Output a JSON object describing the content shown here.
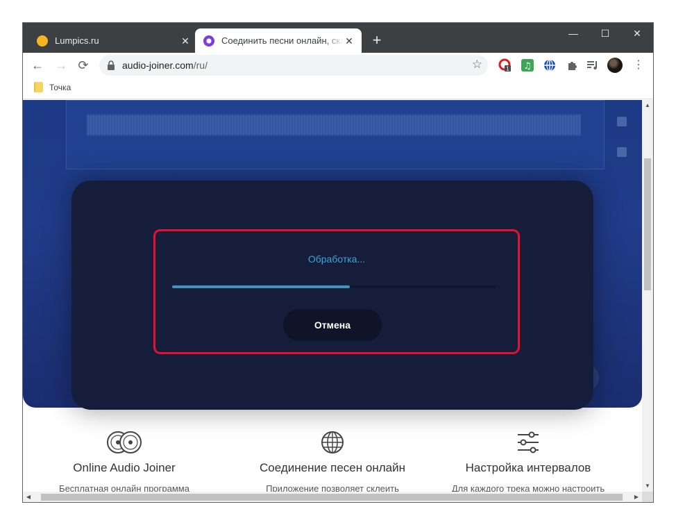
{
  "tabs": [
    {
      "title": "Lumpics.ru",
      "favicon_color": "#f4b623",
      "close": "✕"
    },
    {
      "title": "Соединить песни онлайн, склеить",
      "favicon_color": "#7b3ce0",
      "close": "✕"
    }
  ],
  "new_tab_label": "+",
  "window_controls": {
    "minimize": "—",
    "maximize": "☐",
    "close": "✕"
  },
  "toolbar": {
    "back": "←",
    "forward": "→",
    "reload": "⟳",
    "url_host": "audio-joiner.com",
    "url_path": "/ru/",
    "ext_badge": "1",
    "star": "☆",
    "menu": "⋮"
  },
  "bookmarks": [
    {
      "label": "Точка"
    }
  ],
  "dialog": {
    "status": "Обработка...",
    "progress_percent": 55,
    "cancel_label": "Отмена"
  },
  "features": [
    {
      "icon": "vinyl-records-icon",
      "title": "Online Audio Joiner",
      "desc": "Бесплатная онлайн программа"
    },
    {
      "icon": "globe-icon",
      "title": "Соединение песен онлайн",
      "desc": "Приложение позволяет склеить"
    },
    {
      "icon": "sliders-icon",
      "title": "Настройка интервалов",
      "desc": "Для каждого трека можно настроить"
    }
  ],
  "colors": {
    "accent": "#39a6d6",
    "highlight": "#e8112d",
    "hero": "#1d3a86"
  }
}
